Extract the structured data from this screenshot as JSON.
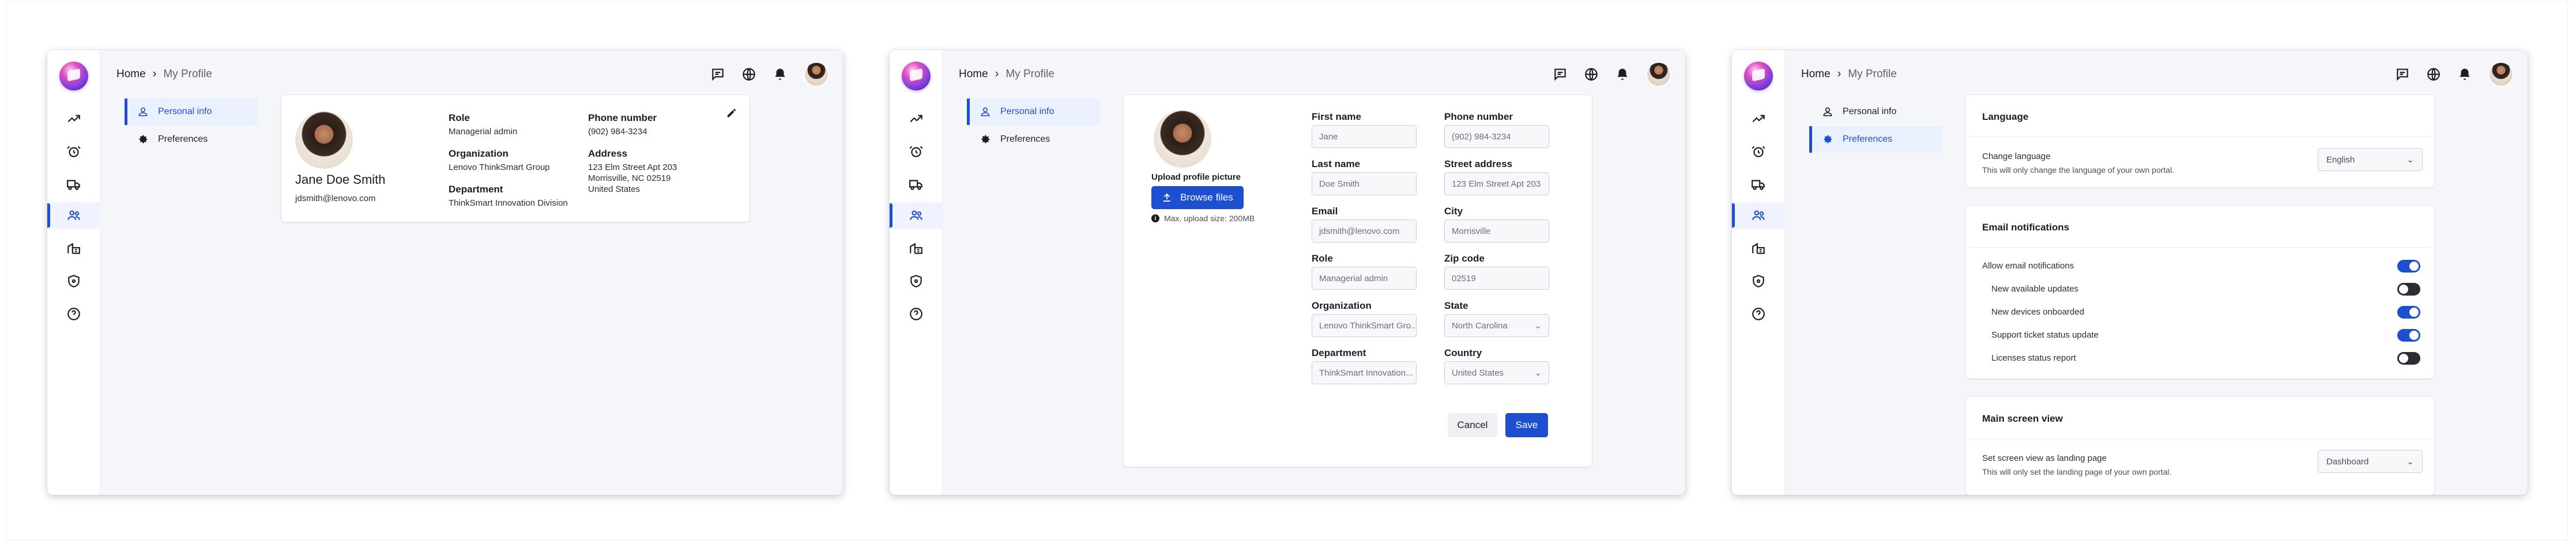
{
  "breadcrumb": {
    "home": "Home",
    "current": "My Profile"
  },
  "subnav": {
    "personal": "Personal info",
    "preferences": "Preferences"
  },
  "rail_icons": [
    "analytics-icon",
    "alarm-icon",
    "truck-icon",
    "users-icon",
    "building-icon",
    "shield-icon",
    "help-icon"
  ],
  "colors": {
    "accent": "#1f4fd1",
    "toggle_off": "#2a2d36"
  },
  "profile": {
    "name": "Jane Doe Smith",
    "email": "jdsmith@lenovo.com",
    "role_label": "Role",
    "role": "Managerial admin",
    "org_label": "Organization",
    "org": "Lenovo ThinkSmart Group",
    "dept_label": "Department",
    "dept": "ThinkSmart Innovation Division",
    "phone_label": "Phone number",
    "phone": "(902) 984-3234",
    "address_label": "Address",
    "address_1": "123 Elm Street Apt 203",
    "address_2": "Morrisville, NC 02519",
    "address_3": "United States"
  },
  "edit": {
    "upload_label": "Upload profile picture",
    "browse": "Browse files",
    "max_size": "Max. upload size: 200MB",
    "first_name_label": "First name",
    "first_name": "Jane",
    "last_name_label": "Last name",
    "last_name": "Doe Smith",
    "email_label": "Email",
    "email": "jdsmith@lenovo.com",
    "role_label": "Role",
    "role": "Managerial admin",
    "org_label": "Organization",
    "org": "Lenovo ThinkSmart Gro...",
    "dept_label": "Department",
    "dept": "ThinkSmart Innovation...",
    "phone_label": "Phone number",
    "phone": "(902) 984-3234",
    "street_label": "Street address",
    "street": "123 Elm Street Apt 203",
    "city_label": "City",
    "city": "Morrisville",
    "zip_label": "Zip code",
    "zip": "02519",
    "state_label": "State",
    "state": "North Carolina",
    "country_label": "Country",
    "country": "United States",
    "cancel": "Cancel",
    "save": "Save"
  },
  "prefs": {
    "language_title": "Language",
    "change_language": "Change language",
    "change_language_note": "This will only change the language of your own portal.",
    "language_value": "English",
    "email_title": "Email notifications",
    "allow_email": "Allow email notifications",
    "notifications": [
      {
        "label": "New available updates",
        "on": false
      },
      {
        "label": "New devices onboarded",
        "on": true
      },
      {
        "label": "Support ticket status update",
        "on": true
      },
      {
        "label": "Licenses status report",
        "on": false
      }
    ],
    "allow_email_on": true,
    "main_view_title": "Main screen view",
    "landing_label": "Set screen view as landing page",
    "landing_note": "This will only set the landing page of your own portal.",
    "landing_value": "Dashboard"
  }
}
